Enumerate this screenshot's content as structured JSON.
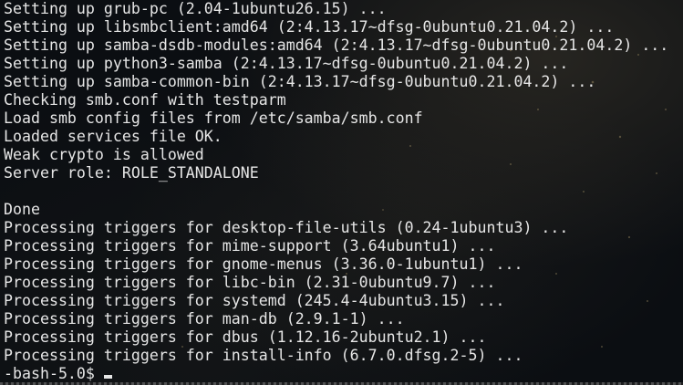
{
  "terminal": {
    "lines": [
      "Setting up grub-pc (2.04-1ubuntu26.15) ...",
      "Setting up libsmbclient:amd64 (2:4.13.17~dfsg-0ubuntu0.21.04.2) ...",
      "Setting up samba-dsdb-modules:amd64 (2:4.13.17~dfsg-0ubuntu0.21.04.2) ...",
      "Setting up python3-samba (2:4.13.17~dfsg-0ubuntu0.21.04.2) ...",
      "Setting up samba-common-bin (2:4.13.17~dfsg-0ubuntu0.21.04.2) ...",
      "Checking smb.conf with testparm",
      "Load smb config files from /etc/samba/smb.conf",
      "Loaded services file OK.",
      "Weak crypto is allowed",
      "Server role: ROLE_STANDALONE",
      "",
      "Done",
      "Processing triggers for desktop-file-utils (0.24-1ubuntu3) ...",
      "Processing triggers for mime-support (3.64ubuntu1) ...",
      "Processing triggers for gnome-menus (3.36.0-1ubuntu1) ...",
      "Processing triggers for libc-bin (2.31-0ubuntu9.7) ...",
      "Processing triggers for systemd (245.4-4ubuntu3.15) ...",
      "Processing triggers for man-db (2.9.1-1) ...",
      "Processing triggers for dbus (1.12.16-2ubuntu2.1) ...",
      "Processing triggers for install-info (6.7.0.dfsg.2-5) ..."
    ],
    "prompt": "-bash-5.0$"
  },
  "colors": {
    "text": "#e6e6e6",
    "background": "#0b0e12"
  }
}
